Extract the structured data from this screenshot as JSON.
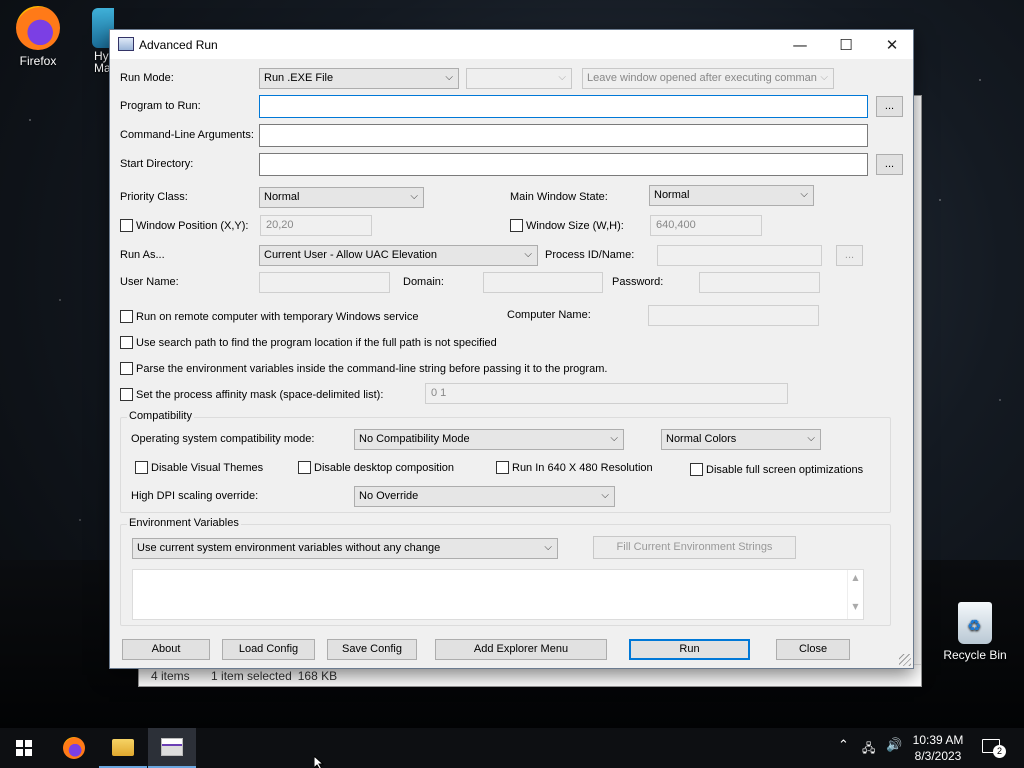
{
  "desktop": {
    "icons": [
      {
        "label": "Firefox"
      },
      {
        "label": "Hy\nMa"
      },
      {
        "label": "Recycle Bin"
      }
    ]
  },
  "bg_window": {
    "items": "4 items",
    "selected": "1 item selected",
    "size": "168 KB"
  },
  "window": {
    "title": "Advanced Run",
    "minimize": "—",
    "maximize": "☐",
    "close": "✕"
  },
  "form": {
    "run_mode_label": "Run Mode:",
    "run_mode": "Run .EXE File",
    "run_mode_extra": "",
    "leave_window": "Leave window opened after executing comman",
    "program_label": "Program to Run:",
    "program_value": "",
    "browse": "...",
    "args_label": "Command-Line Arguments:",
    "args_value": "",
    "startdir_label": "Start Directory:",
    "startdir_value": "",
    "priority_label": "Priority Class:",
    "priority": "Normal",
    "mainwin_label": "Main Window State:",
    "mainwin": "Normal",
    "winpos_label": "Window Position (X,Y):",
    "winpos": "20,20",
    "winsize_label": "Window Size (W,H):",
    "winsize": "640,400",
    "runas_label": "Run As...",
    "runas": "Current User - Allow UAC Elevation",
    "pid_label": "Process ID/Name:",
    "user_label": "User Name:",
    "domain_label": "Domain:",
    "password_label": "Password:",
    "remote_label": "Run on remote computer with temporary Windows service",
    "computer_label": "Computer Name:",
    "searchpath_label": "Use search path to find the program location if the full path is not specified",
    "parseenv_label": "Parse the environment variables inside the command-line string before passing it to the program.",
    "affinity_label": "Set the process affinity mask (space-delimited list):",
    "affinity": "0 1"
  },
  "compat": {
    "group": "Compatibility",
    "os_label": "Operating system compatibility mode:",
    "os_mode": "No Compatibility Mode",
    "colors": "Normal Colors",
    "themes": "Disable Visual Themes",
    "desktop": "Disable desktop composition",
    "res": "Run In 640 X 480 Resolution",
    "fullscreen": "Disable full screen optimizations",
    "dpi_label": "High DPI scaling override:",
    "dpi": "No Override"
  },
  "env": {
    "group": "Environment Variables",
    "mode": "Use current system environment variables without any change",
    "fill": "Fill Current Environment Strings"
  },
  "buttons": {
    "about": "About",
    "load": "Load Config",
    "save": "Save Config",
    "explorer": "Add Explorer Menu",
    "run": "Run",
    "close": "Close"
  },
  "taskbar": {
    "time": "10:39 AM",
    "date": "8/3/2023",
    "notifications": "2"
  },
  "colors": {
    "accent": "#0078d7",
    "taskbar": "#0d0f12"
  }
}
